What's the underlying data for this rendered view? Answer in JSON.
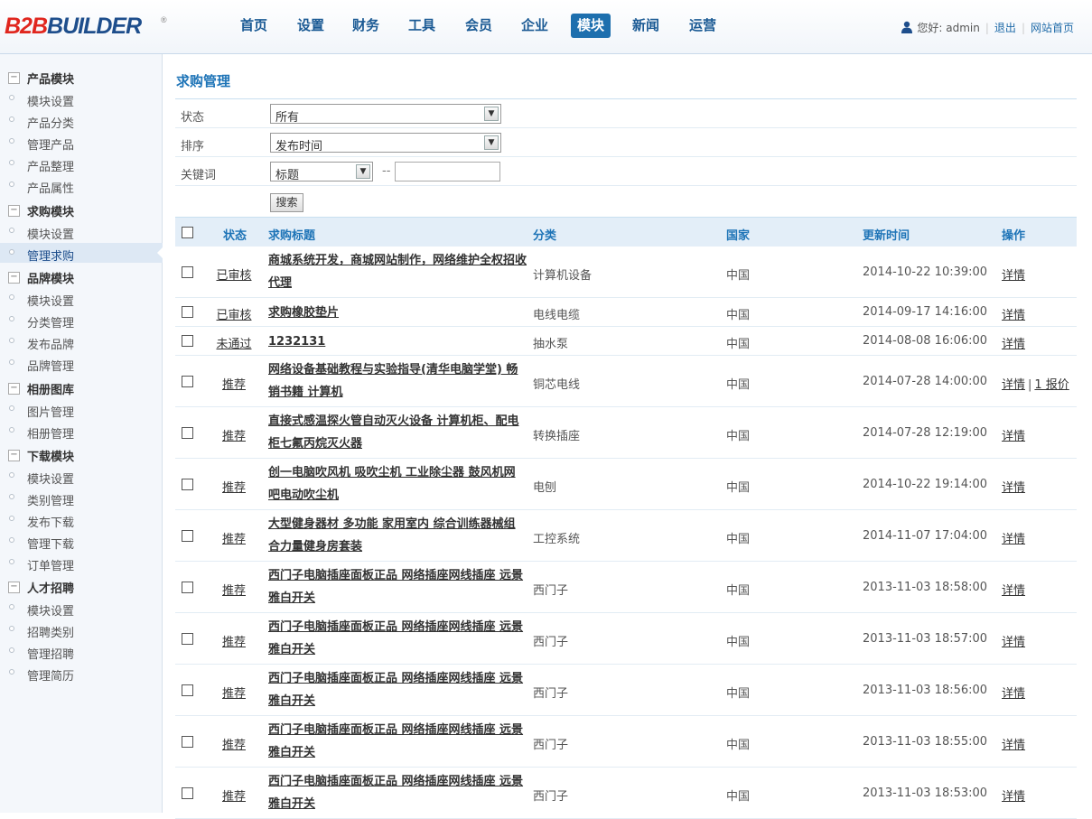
{
  "header": {
    "logo": {
      "b2b": "B2B",
      "builder": "BUILDER",
      "reg": "®"
    },
    "nav": [
      "首页",
      "设置",
      "财务",
      "工具",
      "会员",
      "企业",
      "模块",
      "新闻",
      "运营"
    ],
    "active_nav": "模块",
    "user": {
      "greeting": "您好: admin",
      "logout": "退出",
      "site_home": "网站首页"
    }
  },
  "sidebar": {
    "groups": [
      {
        "title": "产品模块",
        "items": [
          "模块设置",
          "产品分类",
          "管理产品",
          "产品整理",
          "产品属性"
        ]
      },
      {
        "title": "求购模块",
        "items": [
          "模块设置",
          "管理求购"
        ]
      },
      {
        "title": "品牌模块",
        "items": [
          "模块设置",
          "分类管理",
          "发布品牌",
          "品牌管理"
        ]
      },
      {
        "title": "相册图库",
        "items": [
          "图片管理",
          "相册管理"
        ]
      },
      {
        "title": "下载模块",
        "items": [
          "模块设置",
          "类别管理",
          "发布下载",
          "管理下载",
          "订单管理"
        ]
      },
      {
        "title": "人才招聘",
        "items": [
          "模块设置",
          "招聘类别",
          "管理招聘",
          "管理简历"
        ]
      }
    ],
    "active_item": "管理求购"
  },
  "main": {
    "title": "求购管理",
    "filters": {
      "status": {
        "label": "状态",
        "value": "所有"
      },
      "sort": {
        "label": "排序",
        "value": "发布时间"
      },
      "keyword": {
        "label": "关键词",
        "field_value": "标题",
        "separator": "--",
        "input_value": ""
      },
      "search_button": "搜索"
    },
    "table": {
      "headers": {
        "status": "状态",
        "title": "求购标题",
        "category": "分类",
        "country": "国家",
        "updated": "更新时间",
        "actions": "操作"
      },
      "rows": [
        {
          "status": "已审核",
          "title": "商城系统开发，商城网站制作，网络维护全权招收代理",
          "category": "计算机设备",
          "country": "中国",
          "updated": "2014-10-22 10:39:00",
          "actions": [
            "详情"
          ]
        },
        {
          "status": "已审核",
          "title": "求购橡胶垫片",
          "category": "电线电缆",
          "country": "中国",
          "updated": "2014-09-17 14:16:00",
          "actions": [
            "详情"
          ]
        },
        {
          "status": "未通过",
          "title": "1232131",
          "category": "抽水泵",
          "country": "中国",
          "updated": "2014-08-08 16:06:00",
          "actions": [
            "详情"
          ]
        },
        {
          "status": "推荐",
          "title": "网络设备基础教程与实验指导(清华电脑学堂) 畅销书籍 计算机",
          "category": "铜芯电线",
          "country": "中国",
          "updated": "2014-07-28 14:00:00",
          "actions": [
            "详情",
            "1 报价"
          ]
        },
        {
          "status": "推荐",
          "title": "直接式感温探火管自动灭火设备 计算机柜、配电柜七氟丙烷灭火器",
          "category": "转换插座",
          "country": "中国",
          "updated": "2014-07-28 12:19:00",
          "actions": [
            "详情"
          ]
        },
        {
          "status": "推荐",
          "title": "创一电脑吹风机 吸吹尘机 工业除尘器 鼓风机网吧电动吹尘机",
          "category": "电刨",
          "country": "中国",
          "updated": "2014-10-22 19:14:00",
          "actions": [
            "详情"
          ]
        },
        {
          "status": "推荐",
          "title": "大型健身器材 多功能 家用室内 综合训练器械组合力量健身房套装",
          "category": "工控系统",
          "country": "中国",
          "updated": "2014-11-07 17:04:00",
          "actions": [
            "详情"
          ]
        },
        {
          "status": "推荐",
          "title": "西门子电脑插座面板正品 网络插座网线插座 远景雅白开关",
          "category": "西门子",
          "country": "中国",
          "updated": "2013-11-03 18:58:00",
          "actions": [
            "详情"
          ]
        },
        {
          "status": "推荐",
          "title": "西门子电脑插座面板正品 网络插座网线插座 远景雅白开关",
          "category": "西门子",
          "country": "中国",
          "updated": "2013-11-03 18:57:00",
          "actions": [
            "详情"
          ]
        },
        {
          "status": "推荐",
          "title": "西门子电脑插座面板正品 网络插座网线插座 远景雅白开关",
          "category": "西门子",
          "country": "中国",
          "updated": "2013-11-03 18:56:00",
          "actions": [
            "详情"
          ]
        },
        {
          "status": "推荐",
          "title": "西门子电脑插座面板正品 网络插座网线插座 远景雅白开关",
          "category": "西门子",
          "country": "中国",
          "updated": "2013-11-03 18:55:00",
          "actions": [
            "详情"
          ]
        },
        {
          "status": "推荐",
          "title": "西门子电脑插座面板正品 网络插座网线插座 远景雅白开关",
          "category": "西门子",
          "country": "中国",
          "updated": "2013-11-03 18:53:00",
          "actions": [
            "详情"
          ]
        }
      ]
    }
  }
}
